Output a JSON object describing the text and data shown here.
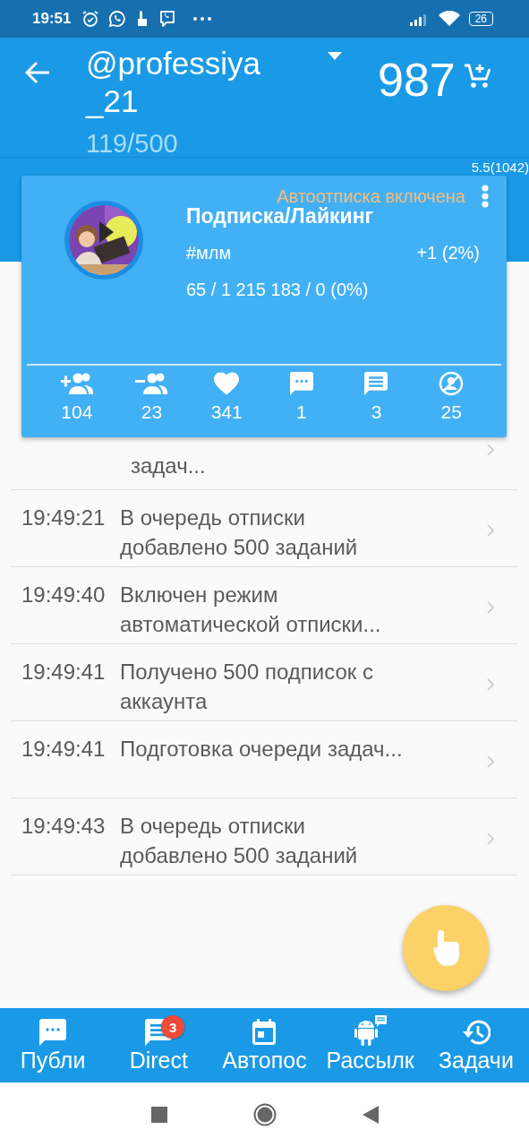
{
  "status_bar": {
    "time": "19:51",
    "battery": "26"
  },
  "header": {
    "title_lines": [
      "@professiya",
      "_21"
    ],
    "counter": "119/500",
    "balance": "987"
  },
  "version": "5.5(1042)",
  "task_card": {
    "status": "Автоотписка включена",
    "title": "Подписка/Лайкинг",
    "tag": "#млм",
    "change": "+1 (2%)",
    "totals": "65 / 1 215 183 / 0 (0%)",
    "stats": [
      {
        "kind": "follow",
        "value": "104"
      },
      {
        "kind": "unfollow",
        "value": "23"
      },
      {
        "kind": "like",
        "value": "341"
      },
      {
        "kind": "comment",
        "value": "1"
      },
      {
        "kind": "message",
        "value": "3"
      },
      {
        "kind": "blocked",
        "value": "25"
      }
    ]
  },
  "log": [
    {
      "message": "задач..."
    },
    {
      "time": "19:49:21",
      "message": "В очередь отписки\nдобавлено 500 заданий"
    },
    {
      "time": "19:49:40",
      "message": "Включен режим\nавтоматической отписки..."
    },
    {
      "time": "19:49:41",
      "message": "Получено 500 подписок с\nаккаунта"
    },
    {
      "time": "19:49:41",
      "message": "Подготовка очереди задач..."
    },
    {
      "time": "19:49:43",
      "message": "В очередь отписки\nдобавлено 500 заданий"
    }
  ],
  "bottom_nav": [
    {
      "kind": "posts",
      "label": "Публи"
    },
    {
      "kind": "direct",
      "label": "Direct",
      "badge": "3"
    },
    {
      "kind": "calendar",
      "label": "Автопос"
    },
    {
      "kind": "android",
      "label": "Рассылк"
    },
    {
      "kind": "history",
      "label": "Задачи"
    }
  ]
}
